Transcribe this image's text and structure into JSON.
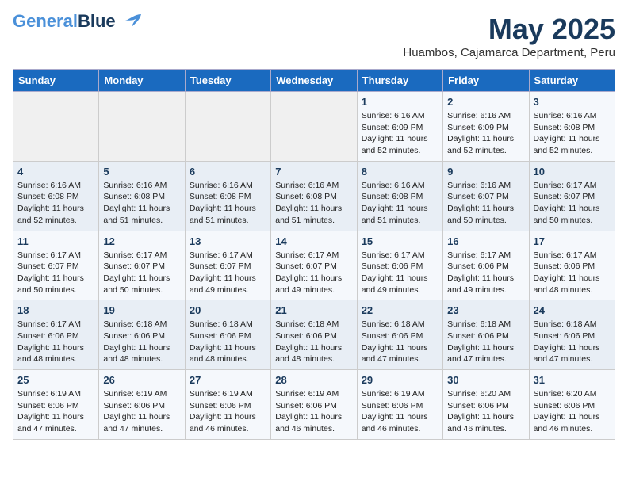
{
  "header": {
    "logo_line1": "General",
    "logo_line2": "Blue",
    "month": "May 2025",
    "location": "Huambos, Cajamarca Department, Peru"
  },
  "days_of_week": [
    "Sunday",
    "Monday",
    "Tuesday",
    "Wednesday",
    "Thursday",
    "Friday",
    "Saturday"
  ],
  "weeks": [
    [
      {
        "day": "",
        "info": ""
      },
      {
        "day": "",
        "info": ""
      },
      {
        "day": "",
        "info": ""
      },
      {
        "day": "",
        "info": ""
      },
      {
        "day": "1",
        "info": "Sunrise: 6:16 AM\nSunset: 6:09 PM\nDaylight: 11 hours\nand 52 minutes."
      },
      {
        "day": "2",
        "info": "Sunrise: 6:16 AM\nSunset: 6:09 PM\nDaylight: 11 hours\nand 52 minutes."
      },
      {
        "day": "3",
        "info": "Sunrise: 6:16 AM\nSunset: 6:08 PM\nDaylight: 11 hours\nand 52 minutes."
      }
    ],
    [
      {
        "day": "4",
        "info": "Sunrise: 6:16 AM\nSunset: 6:08 PM\nDaylight: 11 hours\nand 52 minutes."
      },
      {
        "day": "5",
        "info": "Sunrise: 6:16 AM\nSunset: 6:08 PM\nDaylight: 11 hours\nand 51 minutes."
      },
      {
        "day": "6",
        "info": "Sunrise: 6:16 AM\nSunset: 6:08 PM\nDaylight: 11 hours\nand 51 minutes."
      },
      {
        "day": "7",
        "info": "Sunrise: 6:16 AM\nSunset: 6:08 PM\nDaylight: 11 hours\nand 51 minutes."
      },
      {
        "day": "8",
        "info": "Sunrise: 6:16 AM\nSunset: 6:08 PM\nDaylight: 11 hours\nand 51 minutes."
      },
      {
        "day": "9",
        "info": "Sunrise: 6:16 AM\nSunset: 6:07 PM\nDaylight: 11 hours\nand 50 minutes."
      },
      {
        "day": "10",
        "info": "Sunrise: 6:17 AM\nSunset: 6:07 PM\nDaylight: 11 hours\nand 50 minutes."
      }
    ],
    [
      {
        "day": "11",
        "info": "Sunrise: 6:17 AM\nSunset: 6:07 PM\nDaylight: 11 hours\nand 50 minutes."
      },
      {
        "day": "12",
        "info": "Sunrise: 6:17 AM\nSunset: 6:07 PM\nDaylight: 11 hours\nand 50 minutes."
      },
      {
        "day": "13",
        "info": "Sunrise: 6:17 AM\nSunset: 6:07 PM\nDaylight: 11 hours\nand 49 minutes."
      },
      {
        "day": "14",
        "info": "Sunrise: 6:17 AM\nSunset: 6:07 PM\nDaylight: 11 hours\nand 49 minutes."
      },
      {
        "day": "15",
        "info": "Sunrise: 6:17 AM\nSunset: 6:06 PM\nDaylight: 11 hours\nand 49 minutes."
      },
      {
        "day": "16",
        "info": "Sunrise: 6:17 AM\nSunset: 6:06 PM\nDaylight: 11 hours\nand 49 minutes."
      },
      {
        "day": "17",
        "info": "Sunrise: 6:17 AM\nSunset: 6:06 PM\nDaylight: 11 hours\nand 48 minutes."
      }
    ],
    [
      {
        "day": "18",
        "info": "Sunrise: 6:17 AM\nSunset: 6:06 PM\nDaylight: 11 hours\nand 48 minutes."
      },
      {
        "day": "19",
        "info": "Sunrise: 6:18 AM\nSunset: 6:06 PM\nDaylight: 11 hours\nand 48 minutes."
      },
      {
        "day": "20",
        "info": "Sunrise: 6:18 AM\nSunset: 6:06 PM\nDaylight: 11 hours\nand 48 minutes."
      },
      {
        "day": "21",
        "info": "Sunrise: 6:18 AM\nSunset: 6:06 PM\nDaylight: 11 hours\nand 48 minutes."
      },
      {
        "day": "22",
        "info": "Sunrise: 6:18 AM\nSunset: 6:06 PM\nDaylight: 11 hours\nand 47 minutes."
      },
      {
        "day": "23",
        "info": "Sunrise: 6:18 AM\nSunset: 6:06 PM\nDaylight: 11 hours\nand 47 minutes."
      },
      {
        "day": "24",
        "info": "Sunrise: 6:18 AM\nSunset: 6:06 PM\nDaylight: 11 hours\nand 47 minutes."
      }
    ],
    [
      {
        "day": "25",
        "info": "Sunrise: 6:19 AM\nSunset: 6:06 PM\nDaylight: 11 hours\nand 47 minutes."
      },
      {
        "day": "26",
        "info": "Sunrise: 6:19 AM\nSunset: 6:06 PM\nDaylight: 11 hours\nand 47 minutes."
      },
      {
        "day": "27",
        "info": "Sunrise: 6:19 AM\nSunset: 6:06 PM\nDaylight: 11 hours\nand 46 minutes."
      },
      {
        "day": "28",
        "info": "Sunrise: 6:19 AM\nSunset: 6:06 PM\nDaylight: 11 hours\nand 46 minutes."
      },
      {
        "day": "29",
        "info": "Sunrise: 6:19 AM\nSunset: 6:06 PM\nDaylight: 11 hours\nand 46 minutes."
      },
      {
        "day": "30",
        "info": "Sunrise: 6:20 AM\nSunset: 6:06 PM\nDaylight: 11 hours\nand 46 minutes."
      },
      {
        "day": "31",
        "info": "Sunrise: 6:20 AM\nSunset: 6:06 PM\nDaylight: 11 hours\nand 46 minutes."
      }
    ]
  ]
}
